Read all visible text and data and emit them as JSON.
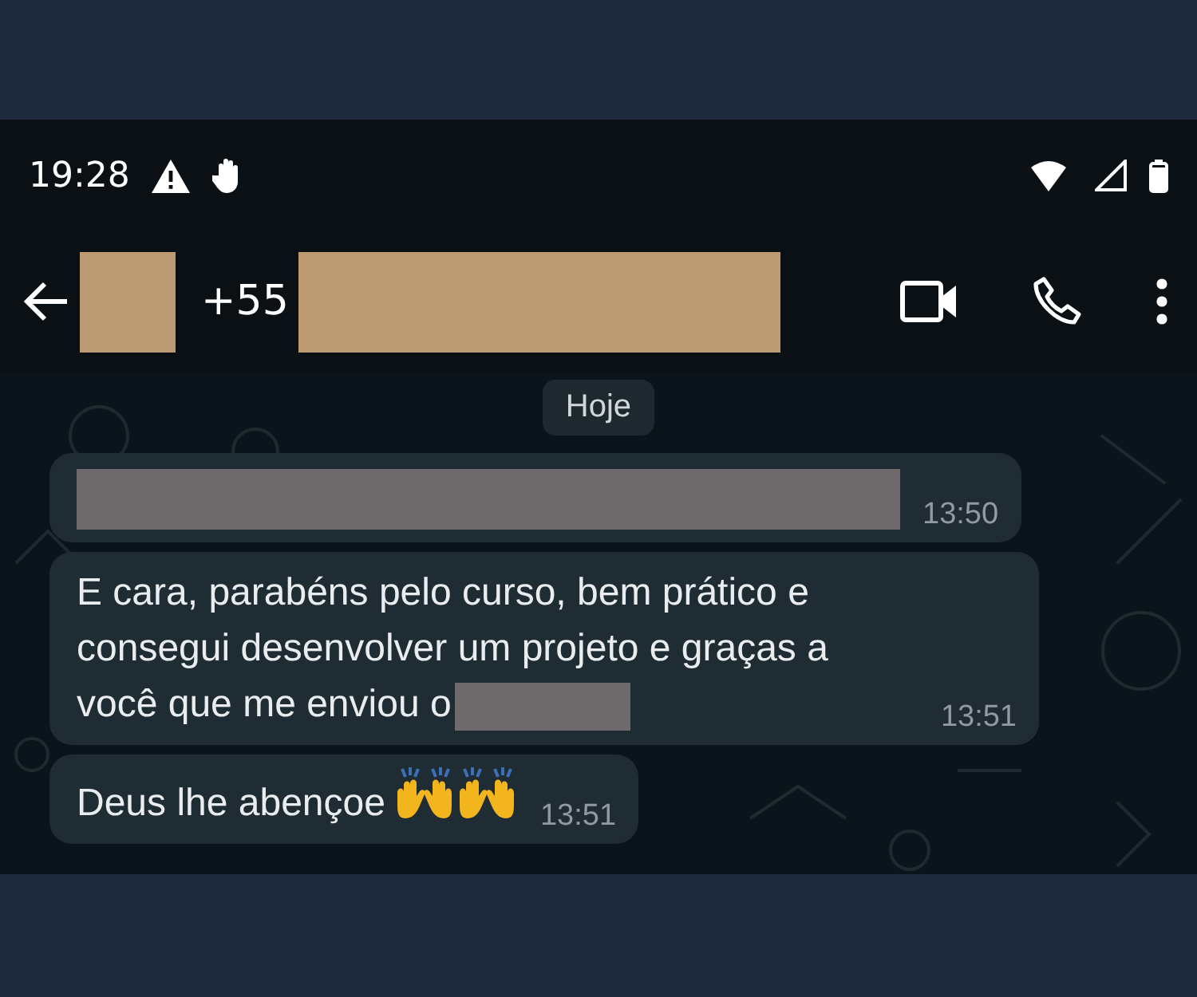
{
  "status_bar": {
    "time": "19:28"
  },
  "header": {
    "phone_prefix": "+55"
  },
  "date_chip": "Hoje",
  "messages": [
    {
      "kind": "redacted",
      "time": "13:50"
    },
    {
      "kind": "text",
      "text": "E cara, parabéns pelo curso, bem prático e consegui desenvolver um projeto e graças a você que me enviou o",
      "redacted_tail": true,
      "time": "13:51"
    },
    {
      "kind": "text",
      "text": "Deus lhe abençoe",
      "trailing_icons": [
        {
          "kind": "raising-hands"
        },
        {
          "kind": "raising-hands"
        }
      ],
      "time": "13:51"
    }
  ]
}
